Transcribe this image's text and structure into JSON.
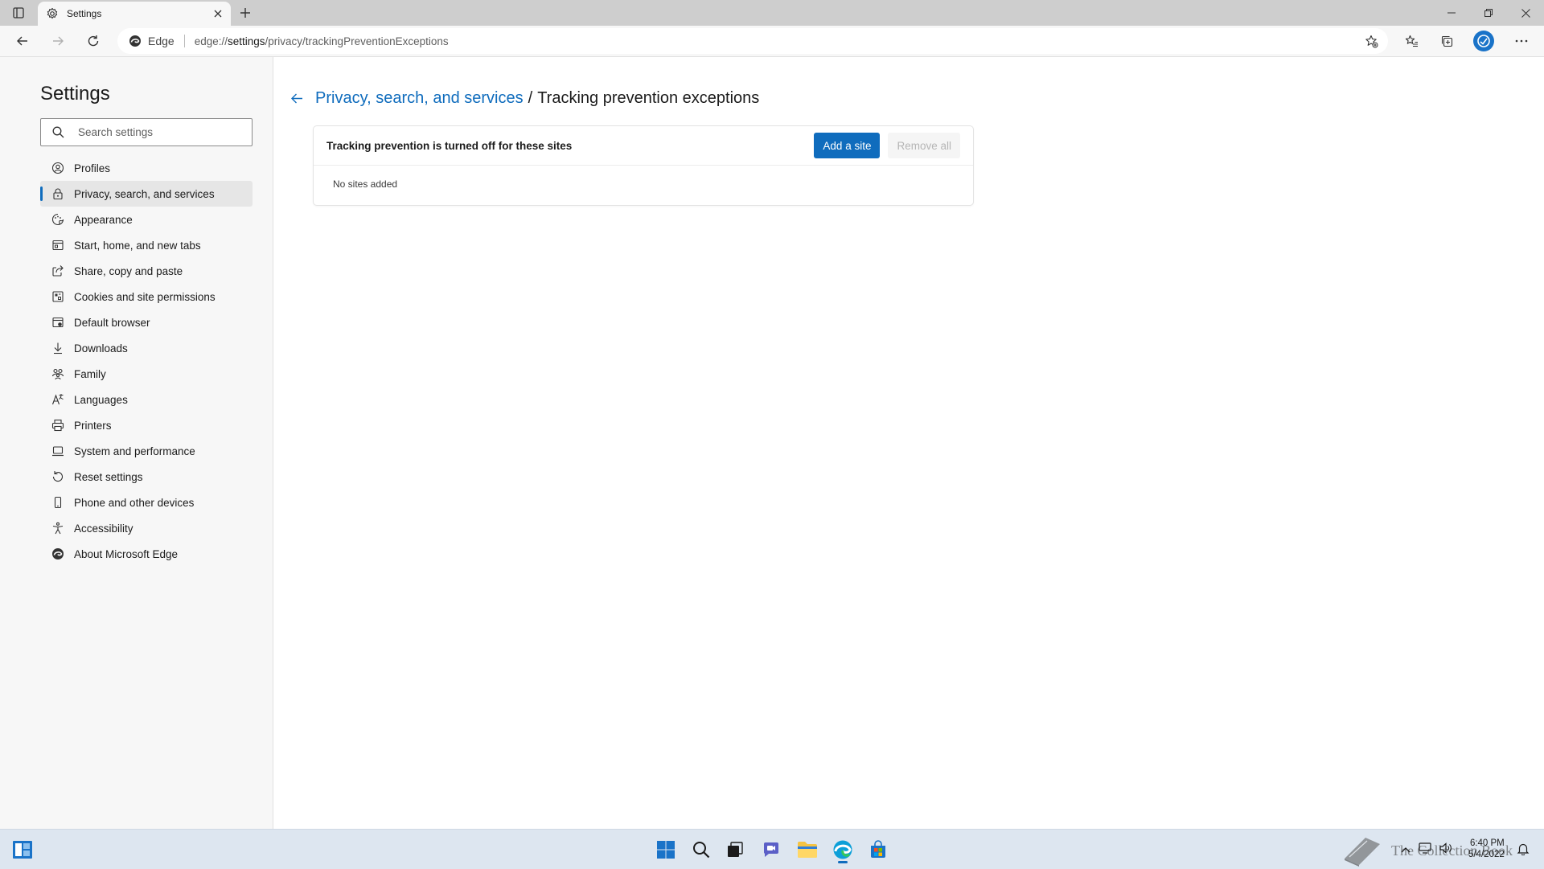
{
  "tab": {
    "title": "Settings"
  },
  "address": {
    "site_label": "Edge",
    "url_scheme": "edge://",
    "url_host": "settings",
    "url_path": "/privacy/trackingPreventionExceptions"
  },
  "sidebar": {
    "title": "Settings",
    "search_placeholder": "Search settings",
    "items": [
      {
        "label": "Profiles",
        "icon": "profile-icon"
      },
      {
        "label": "Privacy, search, and services",
        "icon": "lock-icon",
        "active": true
      },
      {
        "label": "Appearance",
        "icon": "appearance-icon"
      },
      {
        "label": "Start, home, and new tabs",
        "icon": "start-icon"
      },
      {
        "label": "Share, copy and paste",
        "icon": "share-icon"
      },
      {
        "label": "Cookies and site permissions",
        "icon": "cookies-icon"
      },
      {
        "label": "Default browser",
        "icon": "default-browser-icon"
      },
      {
        "label": "Downloads",
        "icon": "download-icon"
      },
      {
        "label": "Family",
        "icon": "family-icon"
      },
      {
        "label": "Languages",
        "icon": "languages-icon"
      },
      {
        "label": "Printers",
        "icon": "printer-icon"
      },
      {
        "label": "System and performance",
        "icon": "laptop-icon"
      },
      {
        "label": "Reset settings",
        "icon": "reset-icon"
      },
      {
        "label": "Phone and other devices",
        "icon": "phone-icon"
      },
      {
        "label": "Accessibility",
        "icon": "accessibility-icon"
      },
      {
        "label": "About Microsoft Edge",
        "icon": "edge-icon"
      }
    ]
  },
  "main": {
    "breadcrumb_parent": "Privacy, search, and services",
    "breadcrumb_separator": "/",
    "breadcrumb_current": "Tracking prevention exceptions",
    "card_title": "Tracking prevention is turned off for these sites",
    "add_button": "Add a site",
    "remove_all_button": "Remove all",
    "empty_text": "No sites added"
  },
  "taskbar": {
    "time": "6:40 PM",
    "date": "5/4/2022",
    "watermark": "The Collection Book"
  },
  "colors": {
    "accent": "#0f6cbd",
    "sidebar_bg": "#f7f7f7",
    "tabstrip_bg": "#cecece"
  }
}
